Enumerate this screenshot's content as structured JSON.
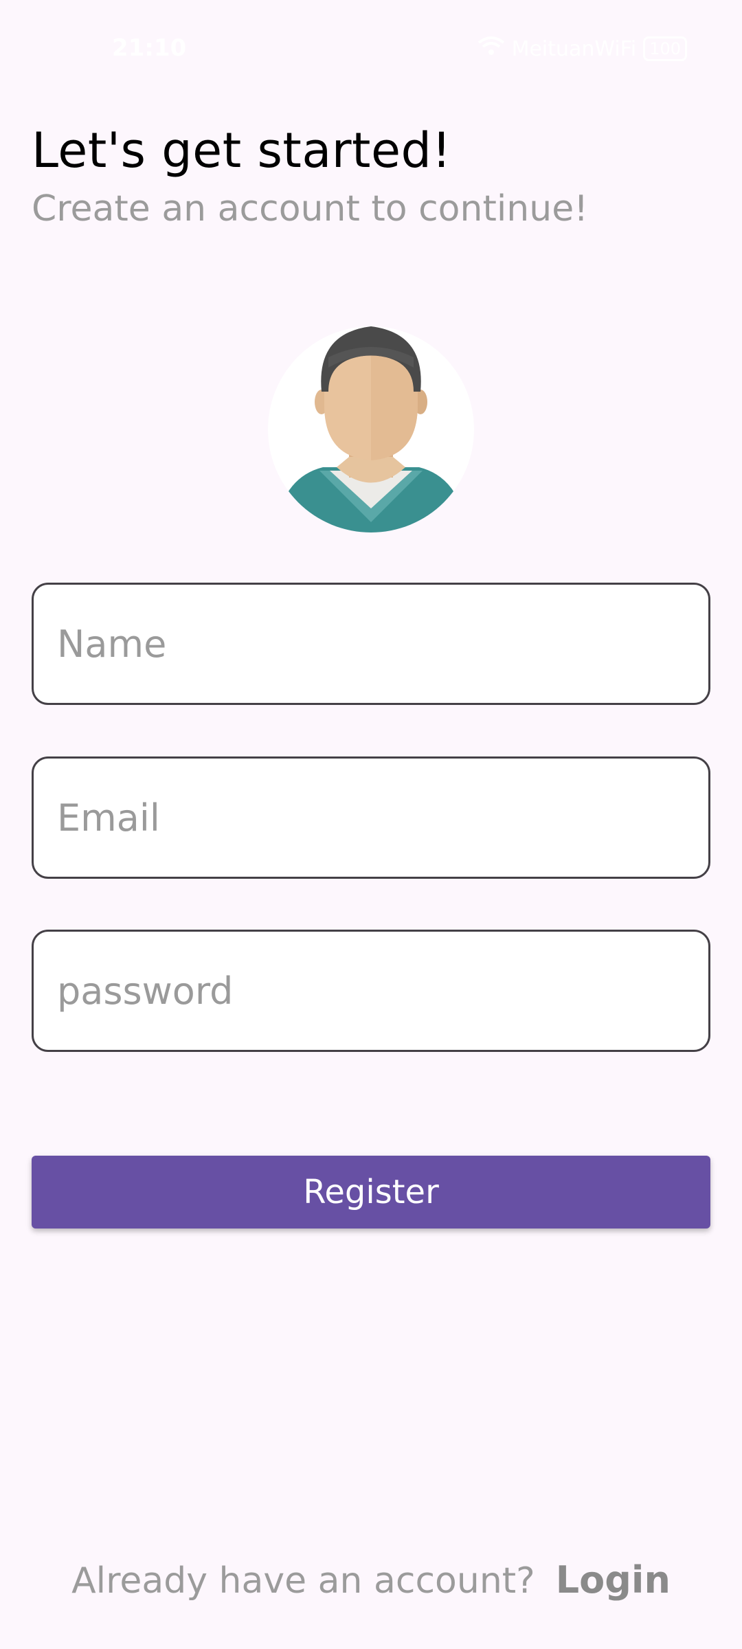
{
  "status_bar": {
    "time": "21:10",
    "network": "MeituanWiFi",
    "battery": "100"
  },
  "header": {
    "title": "Let's get started!",
    "subtitle": "Create an account to continue!"
  },
  "form": {
    "name_placeholder": "Name",
    "email_placeholder": "Email",
    "password_placeholder": "password",
    "register_label": "Register"
  },
  "footer": {
    "prompt": "Already have an account?",
    "login_label": "Login"
  },
  "colors": {
    "background": "#fdf7fd",
    "primary": "#6750a4",
    "muted_text": "#9b9b9b",
    "field_border": "#444046"
  },
  "icons": {
    "avatar": "user-avatar-icon",
    "wifi": "wifi-icon",
    "battery": "battery-icon"
  }
}
